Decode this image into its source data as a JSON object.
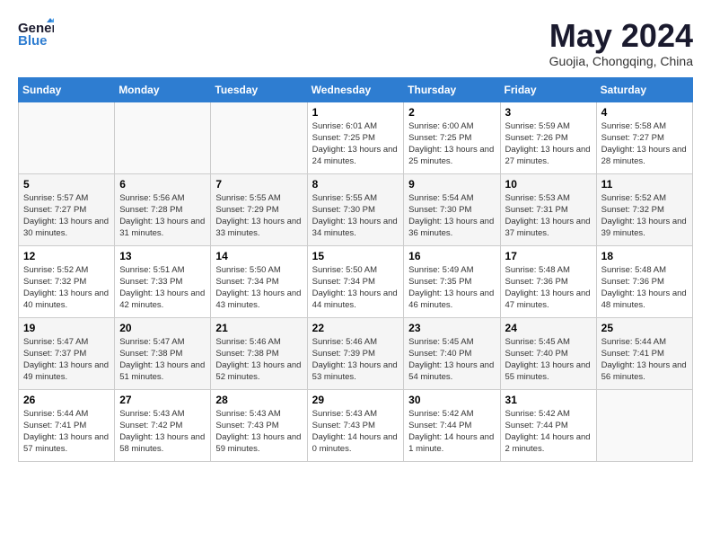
{
  "logo": {
    "general": "General",
    "blue": "Blue"
  },
  "title": "May 2024",
  "subtitle": "Guojia, Chongqing, China",
  "weekdays": [
    "Sunday",
    "Monday",
    "Tuesday",
    "Wednesday",
    "Thursday",
    "Friday",
    "Saturday"
  ],
  "weeks": [
    [
      {
        "day": "",
        "sunrise": "",
        "sunset": "",
        "daylight": ""
      },
      {
        "day": "",
        "sunrise": "",
        "sunset": "",
        "daylight": ""
      },
      {
        "day": "",
        "sunrise": "",
        "sunset": "",
        "daylight": ""
      },
      {
        "day": "1",
        "sunrise": "Sunrise: 6:01 AM",
        "sunset": "Sunset: 7:25 PM",
        "daylight": "Daylight: 13 hours and 24 minutes."
      },
      {
        "day": "2",
        "sunrise": "Sunrise: 6:00 AM",
        "sunset": "Sunset: 7:25 PM",
        "daylight": "Daylight: 13 hours and 25 minutes."
      },
      {
        "day": "3",
        "sunrise": "Sunrise: 5:59 AM",
        "sunset": "Sunset: 7:26 PM",
        "daylight": "Daylight: 13 hours and 27 minutes."
      },
      {
        "day": "4",
        "sunrise": "Sunrise: 5:58 AM",
        "sunset": "Sunset: 7:27 PM",
        "daylight": "Daylight: 13 hours and 28 minutes."
      }
    ],
    [
      {
        "day": "5",
        "sunrise": "Sunrise: 5:57 AM",
        "sunset": "Sunset: 7:27 PM",
        "daylight": "Daylight: 13 hours and 30 minutes."
      },
      {
        "day": "6",
        "sunrise": "Sunrise: 5:56 AM",
        "sunset": "Sunset: 7:28 PM",
        "daylight": "Daylight: 13 hours and 31 minutes."
      },
      {
        "day": "7",
        "sunrise": "Sunrise: 5:55 AM",
        "sunset": "Sunset: 7:29 PM",
        "daylight": "Daylight: 13 hours and 33 minutes."
      },
      {
        "day": "8",
        "sunrise": "Sunrise: 5:55 AM",
        "sunset": "Sunset: 7:30 PM",
        "daylight": "Daylight: 13 hours and 34 minutes."
      },
      {
        "day": "9",
        "sunrise": "Sunrise: 5:54 AM",
        "sunset": "Sunset: 7:30 PM",
        "daylight": "Daylight: 13 hours and 36 minutes."
      },
      {
        "day": "10",
        "sunrise": "Sunrise: 5:53 AM",
        "sunset": "Sunset: 7:31 PM",
        "daylight": "Daylight: 13 hours and 37 minutes."
      },
      {
        "day": "11",
        "sunrise": "Sunrise: 5:52 AM",
        "sunset": "Sunset: 7:32 PM",
        "daylight": "Daylight: 13 hours and 39 minutes."
      }
    ],
    [
      {
        "day": "12",
        "sunrise": "Sunrise: 5:52 AM",
        "sunset": "Sunset: 7:32 PM",
        "daylight": "Daylight: 13 hours and 40 minutes."
      },
      {
        "day": "13",
        "sunrise": "Sunrise: 5:51 AM",
        "sunset": "Sunset: 7:33 PM",
        "daylight": "Daylight: 13 hours and 42 minutes."
      },
      {
        "day": "14",
        "sunrise": "Sunrise: 5:50 AM",
        "sunset": "Sunset: 7:34 PM",
        "daylight": "Daylight: 13 hours and 43 minutes."
      },
      {
        "day": "15",
        "sunrise": "Sunrise: 5:50 AM",
        "sunset": "Sunset: 7:34 PM",
        "daylight": "Daylight: 13 hours and 44 minutes."
      },
      {
        "day": "16",
        "sunrise": "Sunrise: 5:49 AM",
        "sunset": "Sunset: 7:35 PM",
        "daylight": "Daylight: 13 hours and 46 minutes."
      },
      {
        "day": "17",
        "sunrise": "Sunrise: 5:48 AM",
        "sunset": "Sunset: 7:36 PM",
        "daylight": "Daylight: 13 hours and 47 minutes."
      },
      {
        "day": "18",
        "sunrise": "Sunrise: 5:48 AM",
        "sunset": "Sunset: 7:36 PM",
        "daylight": "Daylight: 13 hours and 48 minutes."
      }
    ],
    [
      {
        "day": "19",
        "sunrise": "Sunrise: 5:47 AM",
        "sunset": "Sunset: 7:37 PM",
        "daylight": "Daylight: 13 hours and 49 minutes."
      },
      {
        "day": "20",
        "sunrise": "Sunrise: 5:47 AM",
        "sunset": "Sunset: 7:38 PM",
        "daylight": "Daylight: 13 hours and 51 minutes."
      },
      {
        "day": "21",
        "sunrise": "Sunrise: 5:46 AM",
        "sunset": "Sunset: 7:38 PM",
        "daylight": "Daylight: 13 hours and 52 minutes."
      },
      {
        "day": "22",
        "sunrise": "Sunrise: 5:46 AM",
        "sunset": "Sunset: 7:39 PM",
        "daylight": "Daylight: 13 hours and 53 minutes."
      },
      {
        "day": "23",
        "sunrise": "Sunrise: 5:45 AM",
        "sunset": "Sunset: 7:40 PM",
        "daylight": "Daylight: 13 hours and 54 minutes."
      },
      {
        "day": "24",
        "sunrise": "Sunrise: 5:45 AM",
        "sunset": "Sunset: 7:40 PM",
        "daylight": "Daylight: 13 hours and 55 minutes."
      },
      {
        "day": "25",
        "sunrise": "Sunrise: 5:44 AM",
        "sunset": "Sunset: 7:41 PM",
        "daylight": "Daylight: 13 hours and 56 minutes."
      }
    ],
    [
      {
        "day": "26",
        "sunrise": "Sunrise: 5:44 AM",
        "sunset": "Sunset: 7:41 PM",
        "daylight": "Daylight: 13 hours and 57 minutes."
      },
      {
        "day": "27",
        "sunrise": "Sunrise: 5:43 AM",
        "sunset": "Sunset: 7:42 PM",
        "daylight": "Daylight: 13 hours and 58 minutes."
      },
      {
        "day": "28",
        "sunrise": "Sunrise: 5:43 AM",
        "sunset": "Sunset: 7:43 PM",
        "daylight": "Daylight: 13 hours and 59 minutes."
      },
      {
        "day": "29",
        "sunrise": "Sunrise: 5:43 AM",
        "sunset": "Sunset: 7:43 PM",
        "daylight": "Daylight: 14 hours and 0 minutes."
      },
      {
        "day": "30",
        "sunrise": "Sunrise: 5:42 AM",
        "sunset": "Sunset: 7:44 PM",
        "daylight": "Daylight: 14 hours and 1 minute."
      },
      {
        "day": "31",
        "sunrise": "Sunrise: 5:42 AM",
        "sunset": "Sunset: 7:44 PM",
        "daylight": "Daylight: 14 hours and 2 minutes."
      },
      {
        "day": "",
        "sunrise": "",
        "sunset": "",
        "daylight": ""
      }
    ]
  ]
}
